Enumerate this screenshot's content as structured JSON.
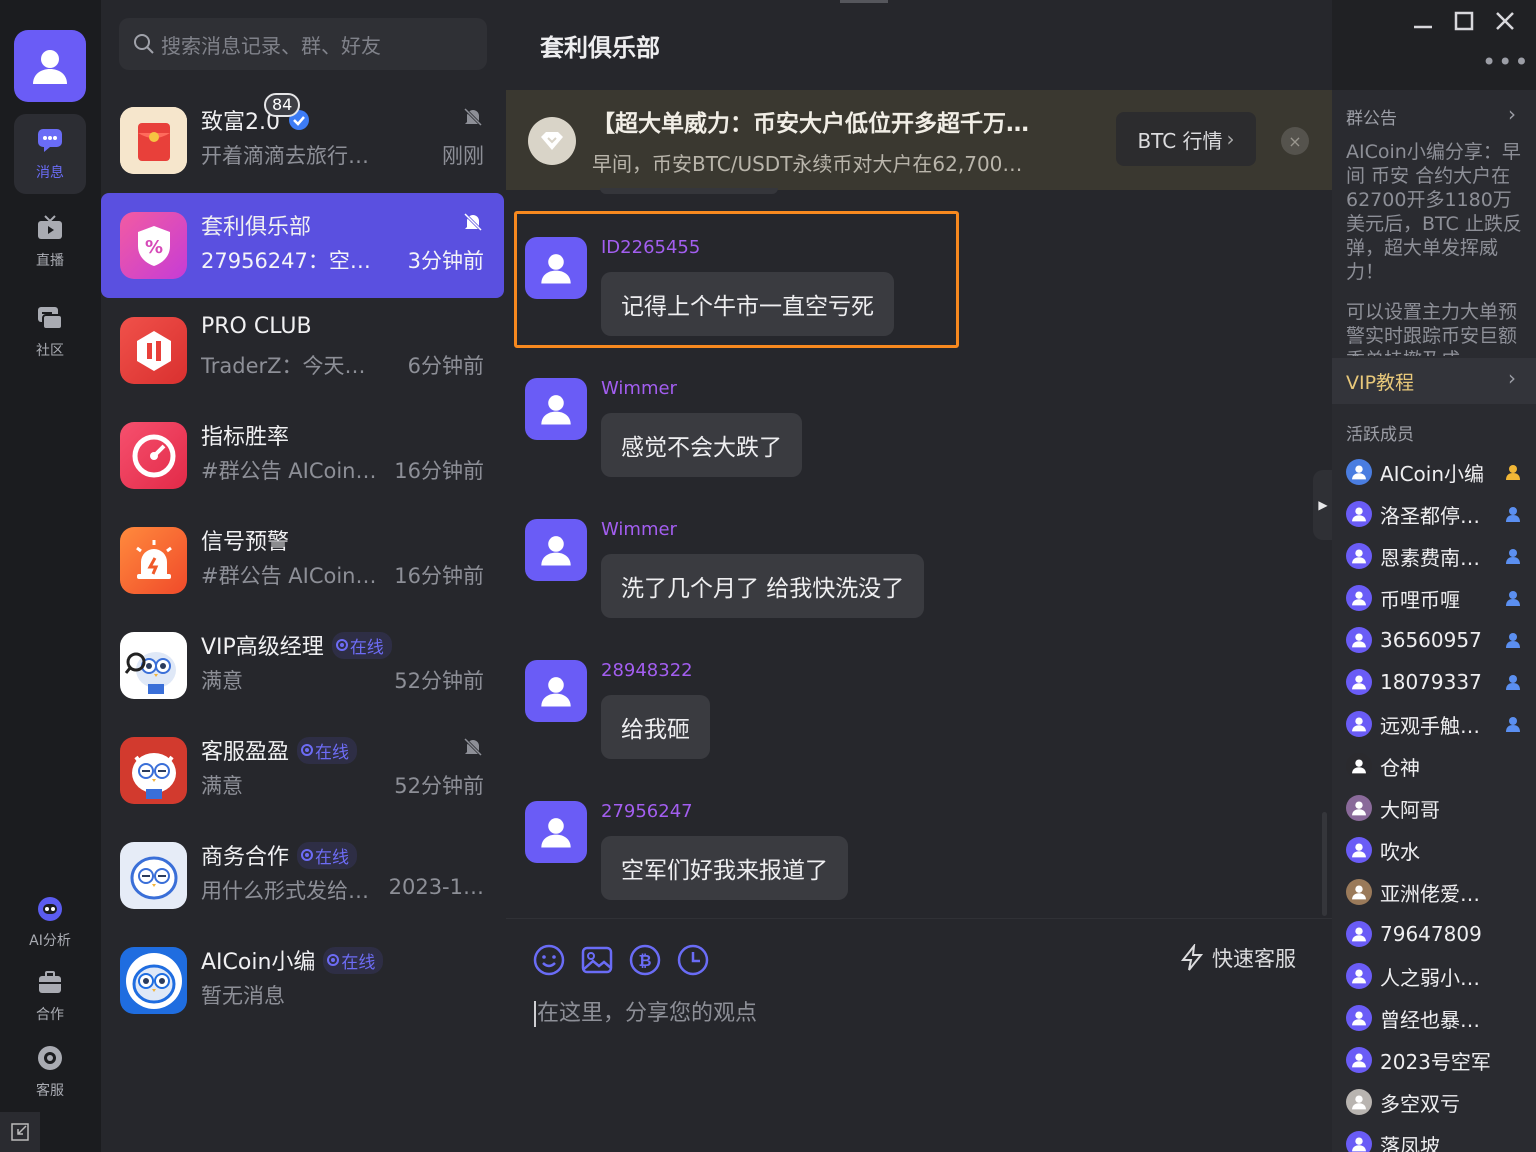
{
  "rail": {
    "items": [
      {
        "label": "消息",
        "icon": "chat-bubble-icon",
        "active": true
      },
      {
        "label": "直播",
        "icon": "tv-icon"
      },
      {
        "label": "社区",
        "icon": "community-icon"
      },
      {
        "label": "AI分析",
        "icon": "robot-icon"
      },
      {
        "label": "合作",
        "icon": "briefcase-icon"
      },
      {
        "label": "客服",
        "icon": "headset-icon"
      }
    ]
  },
  "search": {
    "placeholder": "搜索消息记录、群、好友"
  },
  "conversations": [
    {
      "title": "致富2.0",
      "preview": "开着滴滴去旅行…",
      "time": "刚刚",
      "badge": "84",
      "verified": true,
      "muted": true
    },
    {
      "title": "套利俱乐部",
      "preview": "27956247：空…",
      "time": "3分钟前",
      "muted": true,
      "active": true
    },
    {
      "title": "PRO CLUB",
      "preview": "TraderZ：今天…",
      "time": "6分钟前"
    },
    {
      "title": "指标胜率",
      "preview": "#群公告 AICoin…",
      "time": "16分钟前"
    },
    {
      "title": "信号预警",
      "preview": "#群公告 AICoin…",
      "time": "16分钟前"
    },
    {
      "title": "VIP高级经理",
      "preview": "满意",
      "time": "52分钟前",
      "online": "在线"
    },
    {
      "title": "客服盈盈",
      "preview": "满意",
      "time": "52分钟前",
      "online": "在线",
      "muted": true
    },
    {
      "title": "商务合作",
      "preview": "用什么形式发给…",
      "time": "2023-1…",
      "online": "在线"
    },
    {
      "title": "AICoin小编",
      "preview": "暂无消息",
      "time": "",
      "online": "在线"
    }
  ],
  "chat": {
    "title": "套利俱乐部",
    "announcement": {
      "title": "【超大单威力：币安大户低位开多超千万…",
      "text": "早间，币安BTC/USDT永续币对大户在62,700…",
      "button": "BTC 行情",
      "close": "×"
    },
    "messages": [
      {
        "sender": "ID2265455",
        "text": "记得上个牛市一直空亏死"
      },
      {
        "sender": "Wimmer",
        "text": "感觉不会大跌了"
      },
      {
        "sender": "Wimmer",
        "text": "洗了几个月了 给我快洗没了"
      },
      {
        "sender": "28948322",
        "text": "给我砸"
      },
      {
        "sender": "27956247",
        "text": "空军们好我来报道了"
      }
    ],
    "composer": {
      "placeholder": "在这里，分享您的观点",
      "quick_service": "快速客服"
    }
  },
  "side": {
    "notice_header": "群公告",
    "notice_text": "AICoin小编分享：早间 币安 合约大户在62700开多1180万美元后，BTC 止跌反弹，超大单发挥威力！",
    "notice_text2": "可以设置主力大单预警实时跟踪币安巨额委单挂撤及成",
    "vip_label": "VIP教程",
    "members_header": "活跃成员",
    "members": [
      {
        "name": "AICoin小编",
        "role": "owner"
      },
      {
        "name": "洛圣都停…",
        "role": "admin"
      },
      {
        "name": "恩素费南…",
        "role": "admin"
      },
      {
        "name": "币哩币喱",
        "role": "admin"
      },
      {
        "name": "36560957",
        "role": "admin"
      },
      {
        "name": "18079337",
        "role": "admin"
      },
      {
        "name": "远观手触…",
        "role": "admin"
      },
      {
        "name": "仓神",
        "role": ""
      },
      {
        "name": "大阿哥",
        "role": ""
      },
      {
        "name": "吹水",
        "role": ""
      },
      {
        "name": "亚洲佬爱…",
        "role": ""
      },
      {
        "name": "79647809",
        "role": ""
      },
      {
        "name": "人之弱小不…",
        "role": ""
      },
      {
        "name": "曾经也暴…",
        "role": ""
      },
      {
        "name": "2023号空军",
        "role": ""
      },
      {
        "name": "多空双亏",
        "role": ""
      },
      {
        "name": "落凤坡",
        "role": ""
      }
    ]
  },
  "colors": {
    "accent": "#6a5cf6",
    "active_row": "#5a50e0",
    "sender_name": "#a35ef0",
    "highlight_border": "#f7891f"
  }
}
